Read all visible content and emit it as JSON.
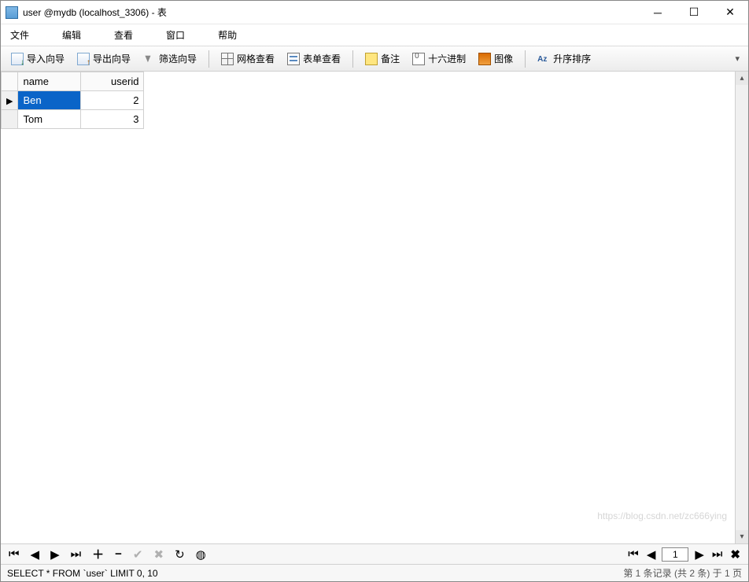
{
  "window": {
    "title": "user @mydb (localhost_3306) - 表"
  },
  "menu": {
    "file": "文件",
    "edit": "编辑",
    "view": "查看",
    "window": "窗口",
    "help": "帮助"
  },
  "toolbar": {
    "import_wizard": "导入向导",
    "export_wizard": "导出向导",
    "filter_wizard": "筛选向导",
    "grid_view": "网格查看",
    "form_view": "表单查看",
    "memo": "备注",
    "hex": "十六进制",
    "image": "图像",
    "sort": "升序排序"
  },
  "table": {
    "columns": {
      "name": "name",
      "userid": "userid"
    },
    "rows": [
      {
        "name": "Ben",
        "userid": "2",
        "selected": true
      },
      {
        "name": "Tom",
        "userid": "3",
        "selected": false
      }
    ]
  },
  "nav": {
    "page_value": "1"
  },
  "status": {
    "sql": "SELECT * FROM `user` LIMIT 0, 10",
    "records": "第 1 条记录 (共 2 条) 于 1 页"
  },
  "watermark": "https://blog.csdn.net/zc666ying"
}
